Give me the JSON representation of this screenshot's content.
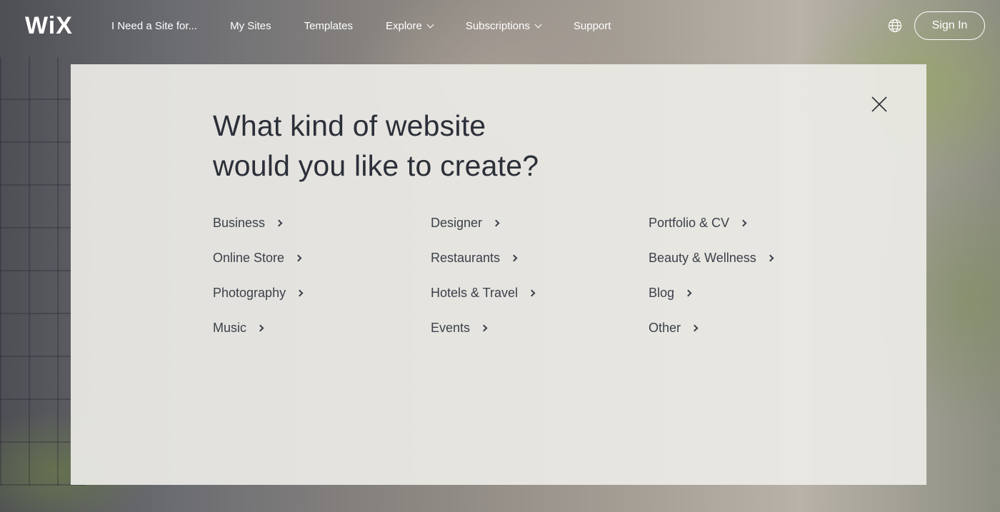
{
  "header": {
    "logo": "WiX",
    "nav": [
      {
        "label": "I Need a Site for...",
        "dropdown": false
      },
      {
        "label": "My Sites",
        "dropdown": false
      },
      {
        "label": "Templates",
        "dropdown": false
      },
      {
        "label": "Explore",
        "dropdown": true
      },
      {
        "label": "Subscriptions",
        "dropdown": true
      },
      {
        "label": "Support",
        "dropdown": false
      }
    ],
    "language_icon": "globe-icon",
    "signin_label": "Sign In"
  },
  "modal": {
    "title_line1": "What kind of website",
    "title_line2": "would you like to create?",
    "close_icon": "close-icon",
    "options": [
      [
        "Business",
        "Designer",
        "Portfolio & CV"
      ],
      [
        "Online Store",
        "Restaurants",
        "Beauty & Wellness"
      ],
      [
        "Photography",
        "Hotels & Travel",
        "Blog"
      ],
      [
        "Music",
        "Events",
        "Other"
      ]
    ]
  },
  "colors": {
    "modal_bg": "#ECEBE6",
    "title_text": "#2B2F38",
    "option_text": "#3C404A",
    "header_text": "#FFFFFF"
  }
}
